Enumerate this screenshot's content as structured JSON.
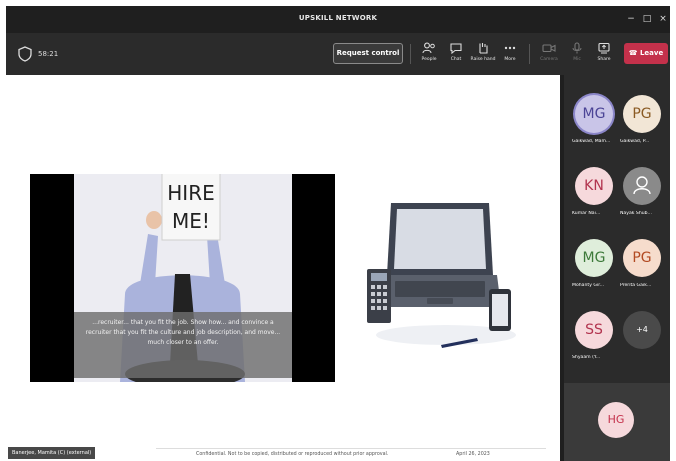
{
  "window": {
    "title": "UPSKILL NETWORK",
    "minimize": "−",
    "maximize": "□",
    "close": "×"
  },
  "toolbar": {
    "timer": "58:21",
    "request_control": "Request control",
    "tools": [
      {
        "icon": "people-icon",
        "label": "People"
      },
      {
        "icon": "chat-icon",
        "label": "Chat"
      },
      {
        "icon": "raise-hand-icon",
        "label": "Raise hand"
      },
      {
        "icon": "more-icon",
        "label": "More"
      },
      {
        "icon": "camera-icon",
        "label": "Camera"
      },
      {
        "icon": "mic-icon",
        "label": "Mic"
      },
      {
        "icon": "share-icon",
        "label": "Share"
      }
    ],
    "leave": "Leave"
  },
  "stage": {
    "caption": "...recruiter... that you fit the job. Show how... and convince a recruiter that you fit the culture and job description, and move... much closer to an offer.",
    "sign_text": "HIRE ME!",
    "footer": "Confidential. Not to be copied, distributed or reproduced without prior approval.",
    "date": "April 26, 2023",
    "presenter": "Banerjee, Mamita (C) (external)"
  },
  "participants": [
    {
      "initials": "MG",
      "name": "Gaikwad, Mam...",
      "bg": "#c9c5e8",
      "fg": "#4b4496",
      "ring": true
    },
    {
      "initials": "PG",
      "name": "Gaikwad, P...",
      "bg": "#f2e6d6",
      "fg": "#8a5a23"
    },
    {
      "initials": "KN",
      "name": "Kumar Nai...",
      "bg": "#f6d9dc",
      "fg": "#b2344f"
    },
    {
      "initials": "",
      "name": "Nayak Shub...",
      "bg": "#8a8a8a",
      "fg": "#ffffff",
      "icon": true
    },
    {
      "initials": "MG",
      "name": "Mohanty Gir...",
      "bg": "#dfeedb",
      "fg": "#3d7a3a"
    },
    {
      "initials": "PG",
      "name": "Prerita Gaik...",
      "bg": "#f6dccc",
      "fg": "#b24a22"
    },
    {
      "initials": "SS",
      "name": "Shyaam (Y...",
      "bg": "#f6d9dc",
      "fg": "#b2344f"
    },
    {
      "initials": "+4",
      "name": "",
      "bg": "#4a4a4a",
      "fg": "#ffffff"
    }
  ],
  "self_view": {
    "initials": "HG"
  },
  "colors": {
    "accent": "#c4314b",
    "panel": "#2b2b2b",
    "titlebar": "#1f1f1f"
  }
}
